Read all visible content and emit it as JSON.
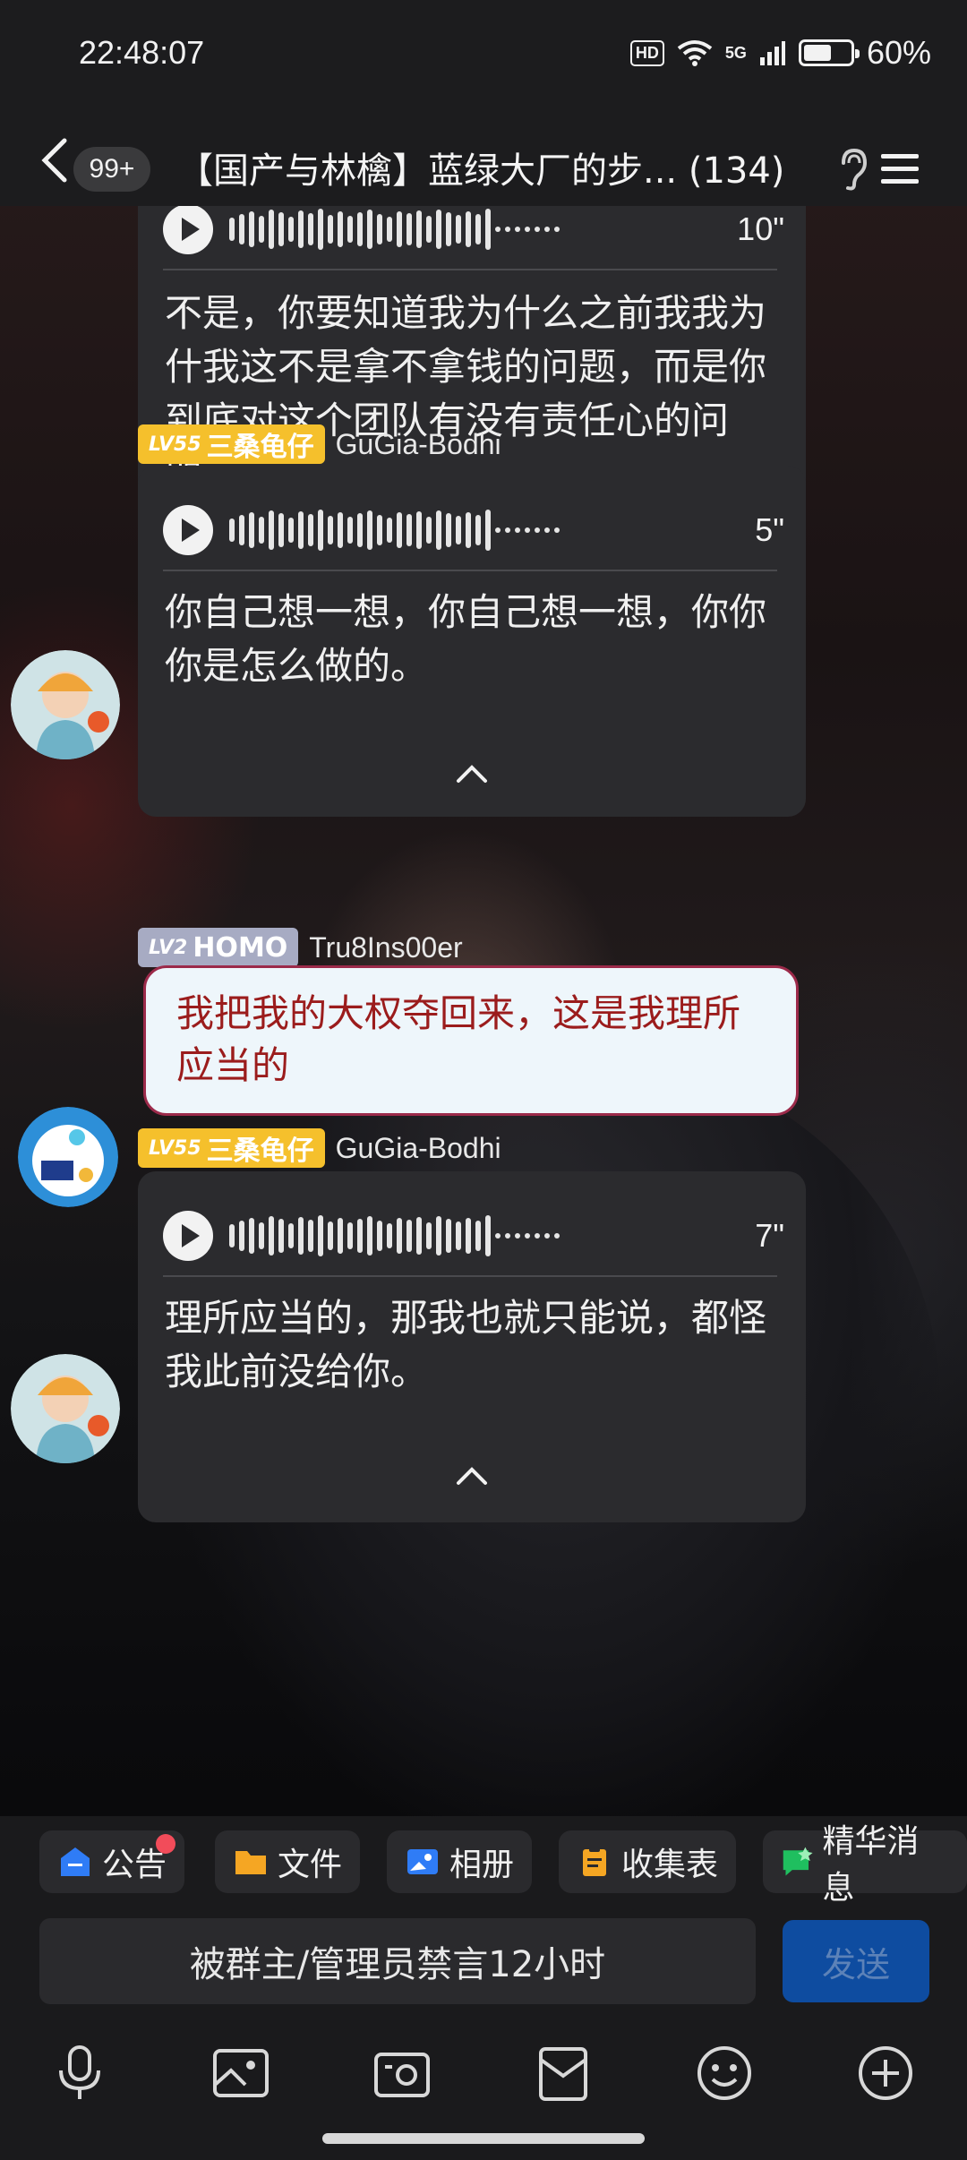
{
  "status_bar": {
    "time": "22:48:07",
    "hd": "HD",
    "network": "5G",
    "battery_percent": "60%",
    "battery_level": 0.6
  },
  "header": {
    "unread_count": "99+",
    "title": "【国产与林檎】蓝绿大厂的步... (134)"
  },
  "messages": [
    {
      "type": "voice",
      "duration": "10\"",
      "transcript": "不是，你要知道我为什么之前我我为什我这不是拿不拿钱的问题，而是你到底对这个团队有没有责任心的问题。"
    },
    {
      "type": "voice",
      "sender": {
        "level": "LV55",
        "title": "三桑龟仔",
        "name": "GuGia-Bodhi"
      },
      "duration": "5\"",
      "transcript": "你自己想一想，你自己想一想，你你你是怎么做的。"
    },
    {
      "type": "text",
      "sender": {
        "level": "LV2",
        "title": "HOMO",
        "name": "Tru8Ins00er"
      },
      "text": "我把我的大权夺回来，这是我理所应当的"
    },
    {
      "type": "voice",
      "sender": {
        "level": "LV55",
        "title": "三桑龟仔",
        "name": "GuGia-Bodhi"
      },
      "duration": "7\"",
      "transcript": "理所应当的，那我也就只能说，都怪我此前没给你。"
    }
  ],
  "chips": [
    {
      "label": "公告",
      "icon": "announcement-icon",
      "has_dot": true
    },
    {
      "label": "文件",
      "icon": "folder-icon"
    },
    {
      "label": "相册",
      "icon": "album-icon"
    },
    {
      "label": "收集表",
      "icon": "clipboard-icon"
    },
    {
      "label": "精华消息",
      "icon": "essence-icon"
    }
  ],
  "input": {
    "status_text": "被群主/管理员禁言12小时",
    "send_label": "发送"
  },
  "toolbar_icons": [
    "microphone-icon",
    "image-icon",
    "camera-icon",
    "red-packet-icon",
    "emoji-icon",
    "plus-icon"
  ],
  "colors": {
    "level55_badge": "#f5c02c",
    "level2_badge": "#a7abc3",
    "send_button": "#0e4ca0",
    "text_bubble_text": "#9b1c1c"
  }
}
